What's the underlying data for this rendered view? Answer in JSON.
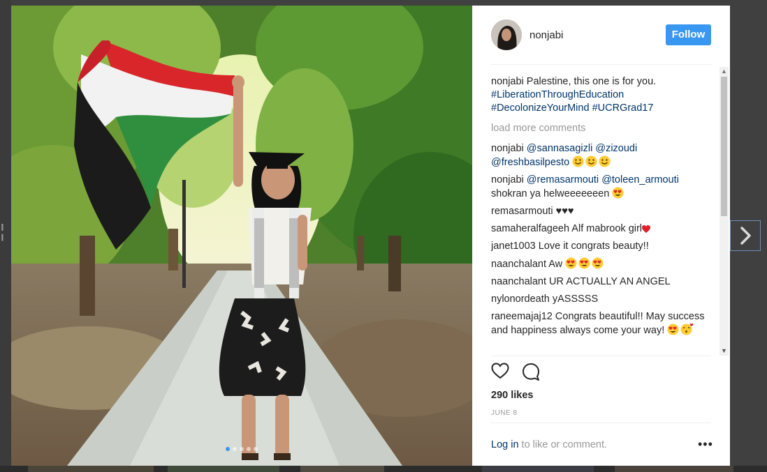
{
  "post": {
    "username": "nonjabi",
    "follow_label": "Follow",
    "caption": {
      "user": "nonjabi",
      "text": "Palestine, this one is for you.",
      "hashtags_line1": "#LiberationThroughEducation",
      "hashtags_line2a": "#DecolonizeYourMind",
      "hashtags_line2b": "#UCRGrad17"
    },
    "load_more": "load more comments",
    "comments": [
      {
        "user": "nonjabi",
        "text": "",
        "mentions": [
          "@sannasagizli",
          "@zizoudi",
          "@freshbasilpesto"
        ],
        "emoji": [
          "grinning-face-emoji",
          "grinning-face-emoji",
          "grinning-face-emoji"
        ]
      },
      {
        "user": "nonjabi",
        "text": "shokran ya helweeeeeeen",
        "mentions": [
          "@remasarmouti",
          "@toleen_armouti"
        ],
        "emoji": [
          "heart-eyes-emoji"
        ]
      },
      {
        "user": "remasarmouti",
        "text": "♥♥♥"
      },
      {
        "user": "samaheralfageeh",
        "text": "Alf mabrook girl",
        "emoji": [
          "red-heart-emoji"
        ]
      },
      {
        "user": "janet1003",
        "text": "Love it congrats beauty!!"
      },
      {
        "user": "naanchalant",
        "text": "Aw",
        "emoji": [
          "heart-eyes-emoji",
          "heart-eyes-emoji",
          "heart-eyes-emoji"
        ]
      },
      {
        "user": "naanchalant",
        "text": "UR ACTUALLY AN ANGEL"
      },
      {
        "user": "nylonordeath",
        "text": "yASSSSS"
      },
      {
        "user": "raneemajaj12",
        "text": "Congrats beautiful!! May success and happiness always come your way!",
        "emoji": [
          "heart-eyes-emoji",
          "kissing-heart-emoji"
        ]
      }
    ],
    "likes": "290 likes",
    "date": "JUNE 8",
    "login_link": "Log in",
    "login_rest": " to like or comment.",
    "more_options": "•••"
  },
  "carousel": {
    "total": 5,
    "active_index": 0
  },
  "icons": [
    "heart-icon",
    "comment-icon",
    "chevron-right-icon",
    "more-options-icon"
  ],
  "colors": {
    "follow_blue": "#3897f0",
    "link_blue": "#003569",
    "muted_gray": "#999999"
  }
}
